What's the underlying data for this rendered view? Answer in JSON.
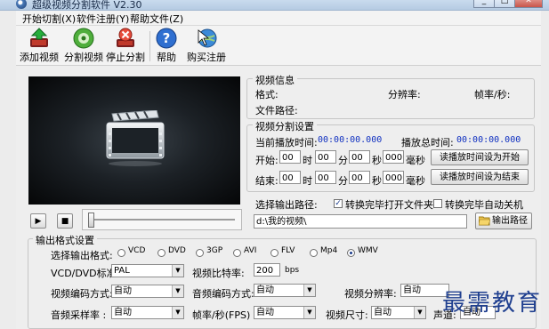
{
  "window": {
    "title": "超级视频分割软件 V2.30"
  },
  "menu": [
    {
      "label": "开始切割(X)"
    },
    {
      "label": "软件注册(Y)"
    },
    {
      "label": "帮助文件(Z)"
    }
  ],
  "toolbar": {
    "add_video": "添加视频",
    "split_video": "分割视频",
    "stop_split": "停止分割",
    "help": "帮助",
    "buy": "购买注册"
  },
  "video_info": {
    "legend": "视频信息",
    "format_label": "格式:",
    "resolution_label": "分辨率:",
    "framerate_label": "帧率/秒:",
    "path_label": "文件路径:"
  },
  "split_settings": {
    "legend": "视频分割设置",
    "current_label": "当前播放时间:",
    "current_value": "00:00:00.000",
    "total_label": "播放总时间:",
    "total_value": "00:00:00.000",
    "start_label": "开始:",
    "end_label": "结束:",
    "hour": "时",
    "minute": "分",
    "second": "秒",
    "ms": "毫秒",
    "start": {
      "h": "00",
      "m": "00",
      "s": "00",
      "ms": "000"
    },
    "end": {
      "h": "00",
      "m": "00",
      "s": "00",
      "ms": "000"
    },
    "set_start_button": "读播放时间设为开始",
    "set_end_button": "读播放时间设为结束"
  },
  "output_path": {
    "label": "选择输出路径:",
    "open_folder_label": "转换完毕打开文件夹",
    "open_folder_checked": true,
    "shutdown_label": "转换完毕自动关机",
    "shutdown_checked": false,
    "path_value": "d:\\我的视频\\",
    "button": "输出路径"
  },
  "output_format": {
    "legend": "输出格式设置",
    "choose_label": "选择输出格式:",
    "formats": [
      "VCD",
      "DVD",
      "3GP",
      "AVI",
      "FLV",
      "Mp4",
      "WMV"
    ],
    "selected": "WMV",
    "standard_label": "VCD/DVD标准:",
    "standard_value": "PAL",
    "bitrate_label": "视频比特率:",
    "bitrate_value": "200",
    "bitrate_unit": "bps",
    "vcodec_label": "视频编码方式:",
    "vcodec_value": "自动",
    "acodec_label": "音频编码方式:",
    "acodec_value": "自动",
    "resolution_label": "视频分辨率:",
    "resolution_value": "自动",
    "samplerate_label": "音频采样率 :",
    "samplerate_value": "自动",
    "fps_label": "帧率/秒(FPS)",
    "fps_value": "自动",
    "size_label": "视频尺寸:",
    "size_value": "自动",
    "audio_label": "声道:",
    "audio_value": "自动"
  },
  "watermark": "最需教育"
}
